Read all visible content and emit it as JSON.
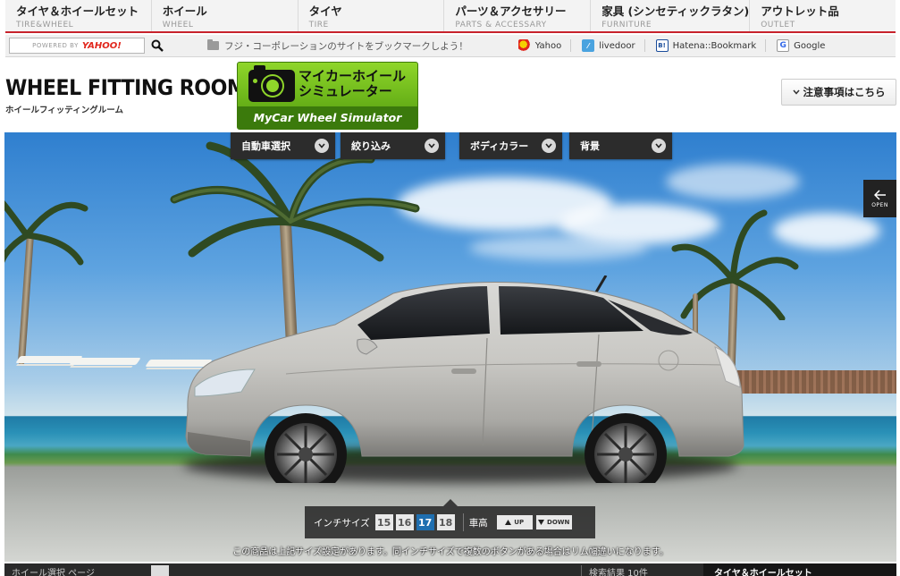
{
  "nav": [
    {
      "jp": "タイヤ＆ホイールセット",
      "en": "TIRE&WHEEL"
    },
    {
      "jp": "ホイール",
      "en": "WHEEL"
    },
    {
      "jp": "タイヤ",
      "en": "TIRE"
    },
    {
      "jp": "パーツ＆アクセサリー",
      "en": "PARTS & ACCESSARY"
    },
    {
      "jp": "家具 (シンセティックラタン)",
      "en": "FURNITURE"
    },
    {
      "jp": "アウトレット品",
      "en": "OUTLET"
    }
  ],
  "utility": {
    "search_powered": "POWERED BY",
    "search_logo": "YAHOO!",
    "bookmark_message": "フジ・コーポレーションのサイトをブックマークしよう！",
    "bookmarks": [
      {
        "label": "Yahoo",
        "icon": "yahoo-icon",
        "glyph": ""
      },
      {
        "label": "livedoor",
        "icon": "livedoor-icon",
        "glyph": "⁄"
      },
      {
        "label": "Hatena::Bookmark",
        "icon": "hatena-icon",
        "glyph": "B!"
      },
      {
        "label": "Google",
        "icon": "google-icon",
        "glyph": "G"
      }
    ]
  },
  "header": {
    "title": "WHEEL FITTING ROOM",
    "subtitle": "ホイールフィッティングルーム",
    "simulator_jp_line1": "マイカーホイール",
    "simulator_jp_line2": "シミュレーター",
    "simulator_en": "MyCar Wheel Simulator",
    "notice_label": "注意事項はこちら"
  },
  "menus": [
    "自動車選択",
    "絞り込み",
    "ボディカラー",
    "背景"
  ],
  "open_label": "OPEN",
  "size_panel": {
    "inch_label": "インチサイズ",
    "sizes": [
      "15",
      "16",
      "17",
      "18"
    ],
    "active_size": "17",
    "height_label": "車高",
    "up_label": "UP",
    "down_label": "DOWN"
  },
  "caption": "この商品は上記サイズ設定があります。同インチサイズで複数のボタンがある場合はリム幅違いになります。",
  "bottom": {
    "left_text": "ホイール選択 ページ",
    "results_text": "検索結果 10件",
    "set_text": "タイヤ＆ホイールセット"
  },
  "colors": {
    "accent_red": "#c8232c",
    "active_size": "#1f6fb0",
    "simulator_green": "#6fb51c"
  }
}
